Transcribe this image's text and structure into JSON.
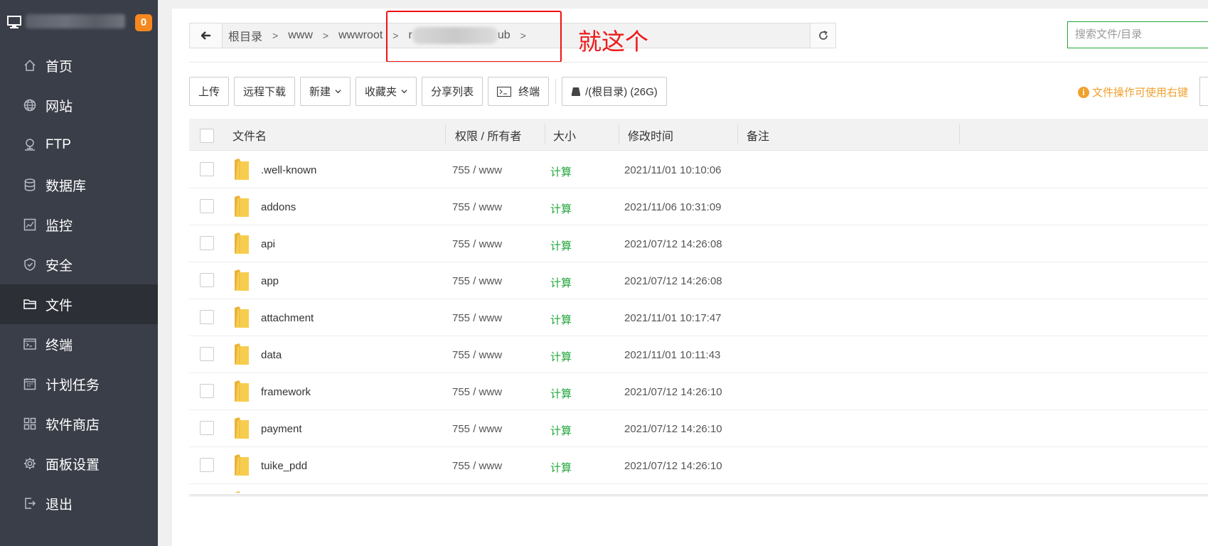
{
  "sidebar": {
    "badge": "0",
    "items": [
      {
        "label": "首页",
        "icon": "home-icon"
      },
      {
        "label": "网站",
        "icon": "globe-icon"
      },
      {
        "label": "FTP",
        "icon": "ftp-icon"
      },
      {
        "label": "数据库",
        "icon": "database-icon"
      },
      {
        "label": "监控",
        "icon": "monitor-chart-icon"
      },
      {
        "label": "安全",
        "icon": "shield-icon"
      },
      {
        "label": "文件",
        "icon": "folder-icon",
        "active": true
      },
      {
        "label": "终端",
        "icon": "terminal-icon"
      },
      {
        "label": "计划任务",
        "icon": "calendar-icon"
      },
      {
        "label": "软件商店",
        "icon": "grid-icon"
      },
      {
        "label": "面板设置",
        "icon": "gear-icon"
      },
      {
        "label": "退出",
        "icon": "logout-icon"
      }
    ]
  },
  "path": {
    "crumbs": [
      "根目录",
      "www",
      "wwwroot"
    ],
    "blurred_prefix": "r",
    "blurred_suffix": "ub",
    "annotation": "就这个"
  },
  "search": {
    "placeholder": "搜索文件/目录"
  },
  "toolbar": {
    "upload": "上传",
    "remote_download": "远程下载",
    "new": "新建",
    "favorites": "收藏夹",
    "share_list": "分享列表",
    "terminal": "终端",
    "disk": "/(根目录) (26G)",
    "hint": "文件操作可使用右键"
  },
  "table": {
    "headers": {
      "name": "文件名",
      "perm": "权限 / 所有者",
      "size": "大小",
      "mtime": "修改时间",
      "note": "备注"
    },
    "rows": [
      {
        "name": ".well-known",
        "perm": "755 / www",
        "size": "计算",
        "mtime": "2021/11/01 10:10:06"
      },
      {
        "name": "addons",
        "perm": "755 / www",
        "size": "计算",
        "mtime": "2021/11/06 10:31:09"
      },
      {
        "name": "api",
        "perm": "755 / www",
        "size": "计算",
        "mtime": "2021/07/12 14:26:08"
      },
      {
        "name": "app",
        "perm": "755 / www",
        "size": "计算",
        "mtime": "2021/07/12 14:26:08"
      },
      {
        "name": "attachment",
        "perm": "755 / www",
        "size": "计算",
        "mtime": "2021/11/01 10:17:47"
      },
      {
        "name": "data",
        "perm": "755 / www",
        "size": "计算",
        "mtime": "2021/11/01 10:11:43"
      },
      {
        "name": "framework",
        "perm": "755 / www",
        "size": "计算",
        "mtime": "2021/07/12 14:26:10"
      },
      {
        "name": "payment",
        "perm": "755 / www",
        "size": "计算",
        "mtime": "2021/07/12 14:26:10"
      },
      {
        "name": "tuike_pdd",
        "perm": "755 / www",
        "size": "计算",
        "mtime": "2021/07/12 14:26:10"
      }
    ]
  },
  "colors": {
    "accent": "#20a53a",
    "sidebar_bg": "#3a3e48",
    "badge": "#f7871f",
    "annotation": "#ee1a1a",
    "hint": "#f0a12e"
  }
}
